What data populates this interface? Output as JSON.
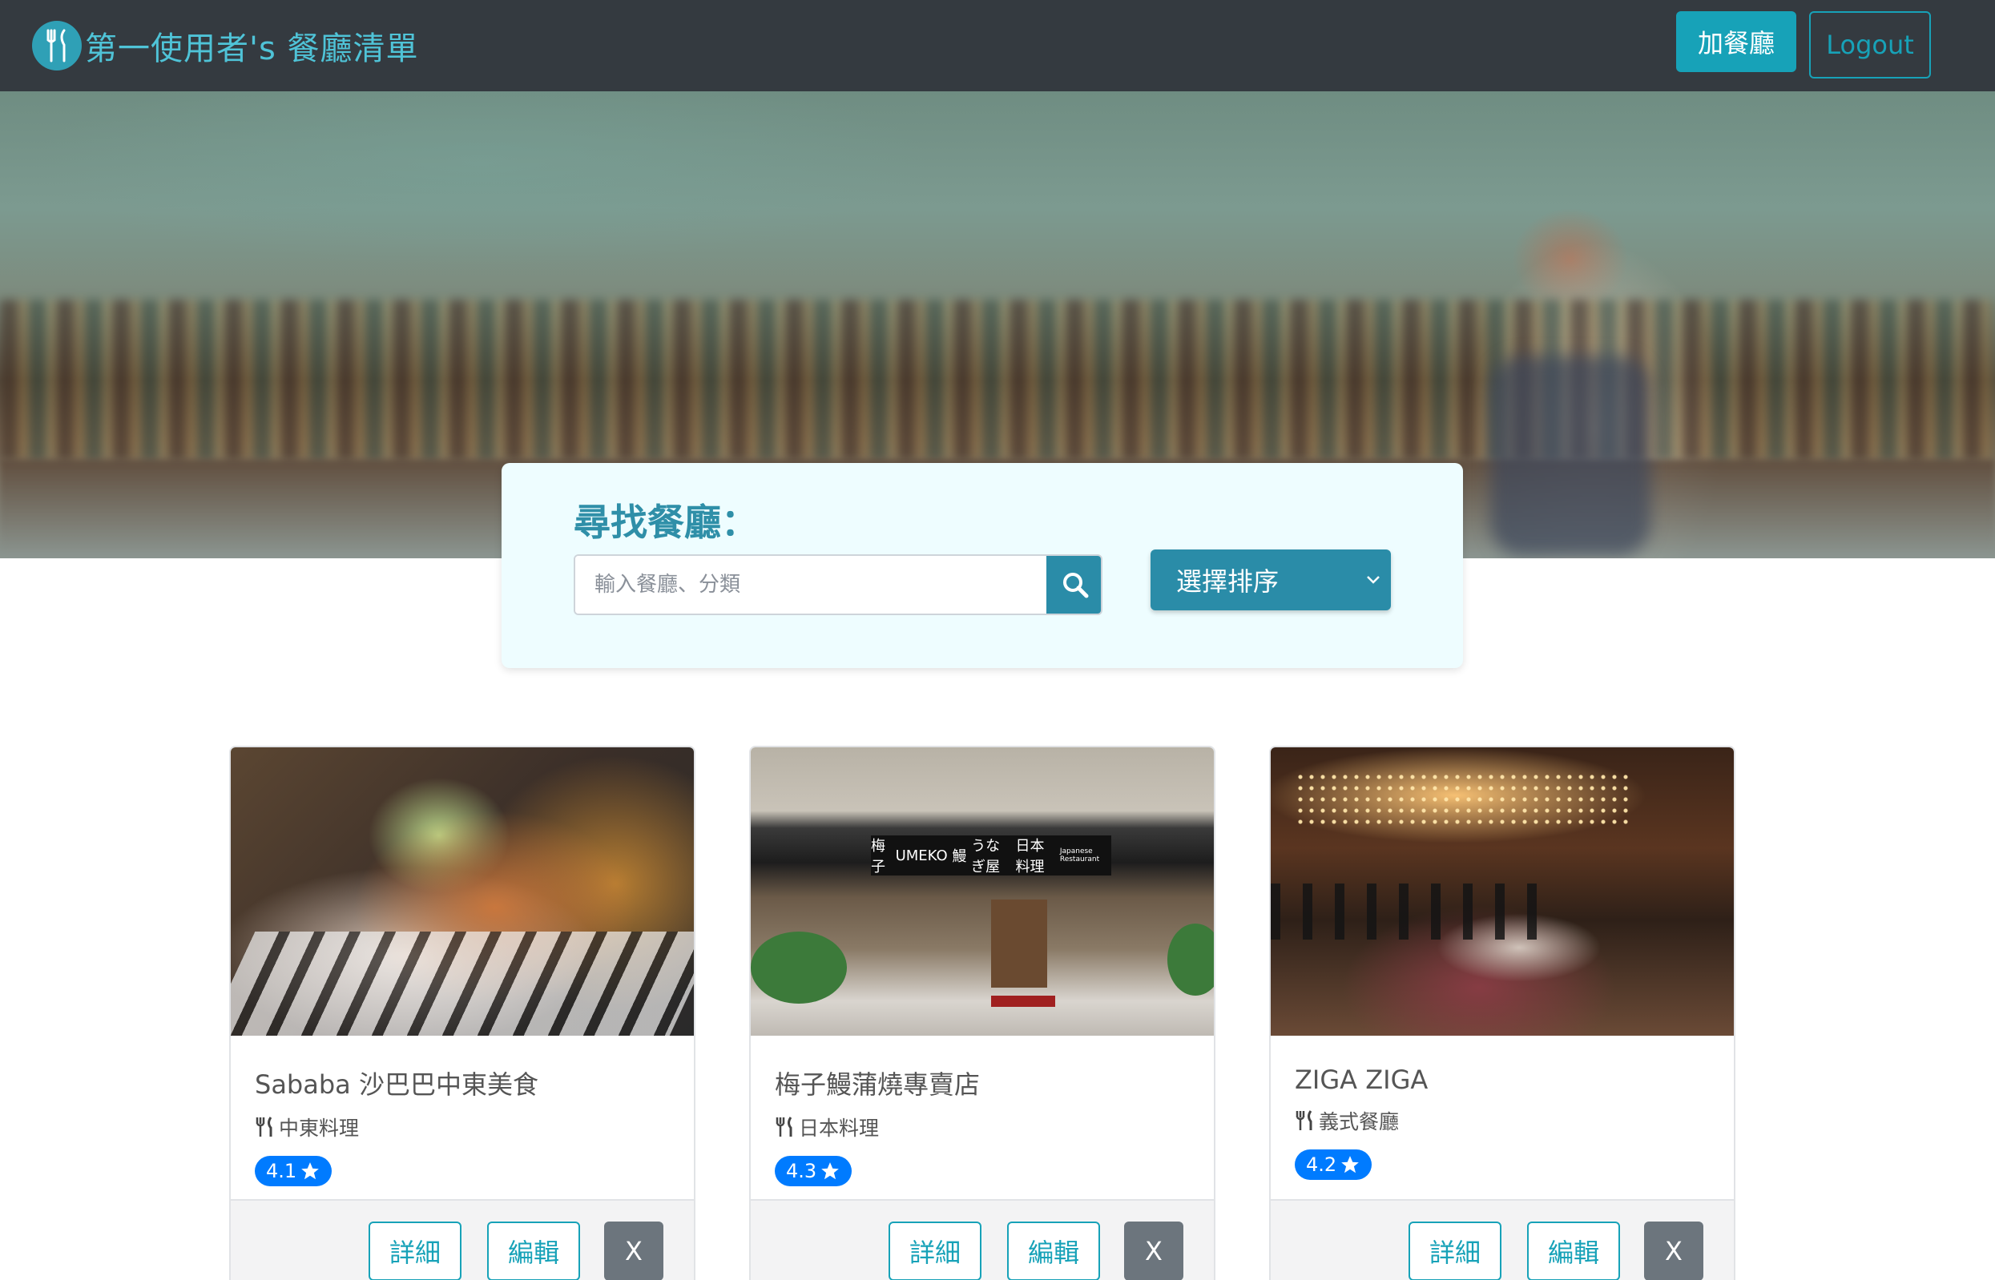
{
  "navbar": {
    "brand_title": "第一使用者's 餐廳清單",
    "add_label": "加餐廳",
    "logout_label": "Logout"
  },
  "search": {
    "title": "尋找餐廳：",
    "placeholder": "輸入餐廳、分類",
    "sort_selected": "選擇排序"
  },
  "restaurants": [
    {
      "name": "Sababa 沙巴巴中東美食",
      "category": "中東料理",
      "rating": "4.1"
    },
    {
      "name": "梅子鰻蒲燒專賣店",
      "category": "日本料理",
      "rating": "4.3"
    },
    {
      "name": "ZIGA ZIGA",
      "category": "義式餐廳",
      "rating": "4.2"
    }
  ],
  "card_actions": {
    "detail_label": "詳細",
    "edit_label": "編輯",
    "delete_label": "X"
  },
  "storefront_sign": {
    "left": "梅子",
    "left_sub": "UMEKO",
    "middle": "鰻",
    "middle_sub": "うなぎ屋",
    "right": "日本料理",
    "right_sub": "Japanese Restaurant"
  },
  "colors": {
    "navbar_bg": "#343a40",
    "accent": "#17a2b8",
    "brand_text": "#4fc3d7",
    "panel_bg": "#eefdff",
    "rating_badge": "#007bff",
    "delete_button": "#6c757d"
  },
  "icons": {
    "brand": "utensils-circle-icon",
    "search": "search-icon",
    "sort": "chevron-down-icon",
    "category": "utensils-icon",
    "rating": "star-icon"
  }
}
